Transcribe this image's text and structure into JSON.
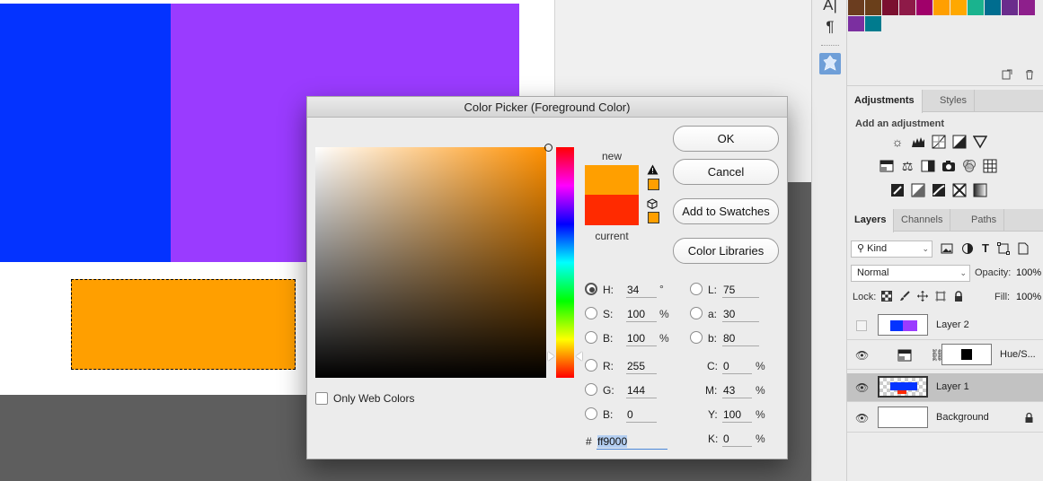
{
  "canvas": {
    "colors": {
      "blue": "#0433ff",
      "purple": "#9a3bff",
      "orange": "#ff9f00"
    }
  },
  "toolstrip": {
    "icons": [
      "type-icon",
      "paragraph-icon",
      "clone-source-icon"
    ],
    "glyphs": {
      "type": "A|",
      "paragraph": "¶"
    }
  },
  "swatches": {
    "colors": [
      "#6b3d1f",
      "#6a3f1a",
      "#7b1030",
      "#8e1a48",
      "#a0006a",
      "#ff9f00",
      "#ffa800",
      "#1ab38e",
      "#006d8f",
      "#6a2c8c",
      "#8e1f8c",
      "#7b2fa0",
      "#007b8e"
    ]
  },
  "adjustments": {
    "tabs": [
      "Adjustments",
      "Styles"
    ],
    "heading": "Add an adjustment",
    "row1": [
      "brightness-contrast-icon",
      "levels-icon",
      "curves-icon",
      "exposure-icon",
      "gradient-triangle-icon"
    ],
    "row2": [
      "hue-saturation-icon",
      "color-balance-icon",
      "black-white-icon",
      "photo-filter-icon",
      "channel-mixer-icon",
      "color-lookup-icon"
    ],
    "row3": [
      "invert-icon",
      "posterize-icon",
      "threshold-icon",
      "selective-color-icon",
      "gradient-map-icon"
    ]
  },
  "layers": {
    "tabs": [
      "Layers",
      "Channels",
      "Paths"
    ],
    "filter_kind": "Kind",
    "blend_mode": "Normal",
    "opacity_label": "Opacity:",
    "opacity_value": "100%",
    "lock_label": "Lock:",
    "fill_label": "Fill:",
    "fill_value": "100%",
    "items": [
      {
        "name": "Layer 2",
        "visible": false,
        "selected": false
      },
      {
        "name": "Hue/S...",
        "visible": true,
        "selected": false
      },
      {
        "name": "Layer 1",
        "visible": true,
        "selected": true
      },
      {
        "name": "Background",
        "visible": true,
        "selected": false
      }
    ]
  },
  "dialog": {
    "title": "Color Picker (Foreground Color)",
    "new_label": "new",
    "current_label": "current",
    "new_color": "#ff9f00",
    "current_color": "#ff2a00",
    "buttons": {
      "ok": "OK",
      "cancel": "Cancel",
      "add_to_swatches": "Add to Swatches",
      "color_libraries": "Color Libraries"
    },
    "hsb": [
      {
        "label": "H:",
        "value": "34",
        "unit": "°",
        "checked": true
      },
      {
        "label": "S:",
        "value": "100",
        "unit": "%",
        "checked": false
      },
      {
        "label": "B:",
        "value": "100",
        "unit": "%",
        "checked": false
      }
    ],
    "rgb": [
      {
        "label": "R:",
        "value": "255"
      },
      {
        "label": "G:",
        "value": "144"
      },
      {
        "label": "B:",
        "value": "0"
      }
    ],
    "lab": [
      {
        "label": "L:",
        "value": "75"
      },
      {
        "label": "a:",
        "value": "30"
      },
      {
        "label": "b:",
        "value": "80"
      }
    ],
    "cmyk": [
      {
        "label": "C:",
        "value": "0",
        "unit": "%"
      },
      {
        "label": "M:",
        "value": "43",
        "unit": "%"
      },
      {
        "label": "Y:",
        "value": "100",
        "unit": "%"
      },
      {
        "label": "K:",
        "value": "0",
        "unit": "%"
      }
    ],
    "hex_prefix": "#",
    "hex_value": "ff9000",
    "only_web_colors": "Only Web Colors",
    "hue_base_color": "#ff9000"
  }
}
